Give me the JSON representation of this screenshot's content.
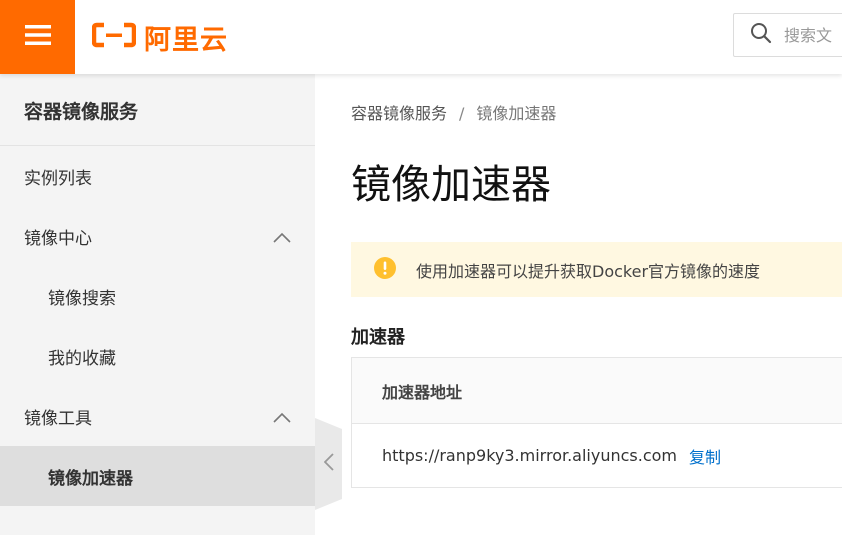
{
  "header": {
    "brand": "阿里云",
    "search_placeholder": "搜索文",
    "brand_color": "#ff6a00",
    "icons": {
      "menu": "hamburger-icon",
      "logo": "aliyun-logo-icon",
      "search": "search-icon"
    }
  },
  "sidebar": {
    "title": "容器镜像服务",
    "items": [
      {
        "label": "实例列表",
        "level": 1
      },
      {
        "label": "镜像中心",
        "level": 1,
        "expanded": true
      },
      {
        "label": "镜像搜索",
        "level": 2
      },
      {
        "label": "我的收藏",
        "level": 2
      },
      {
        "label": "镜像工具",
        "level": 1,
        "expanded": true
      },
      {
        "label": "镜像加速器",
        "level": 2,
        "active": true
      }
    ],
    "collapse_icon": "chevron-left-icon"
  },
  "breadcrumb": {
    "items": [
      "容器镜像服务",
      "镜像加速器"
    ],
    "separator": "/"
  },
  "page": {
    "title": "镜像加速器",
    "notice": {
      "text": "使用加速器可以提升获取Docker官方镜像的速度",
      "icon": "warning-icon",
      "color": "#fff8e1"
    },
    "section_title": "加速器",
    "table": {
      "header": "加速器地址",
      "rows": [
        {
          "url": "https://ranp9ky3.mirror.aliyuncs.com",
          "action": "复制"
        }
      ]
    }
  }
}
